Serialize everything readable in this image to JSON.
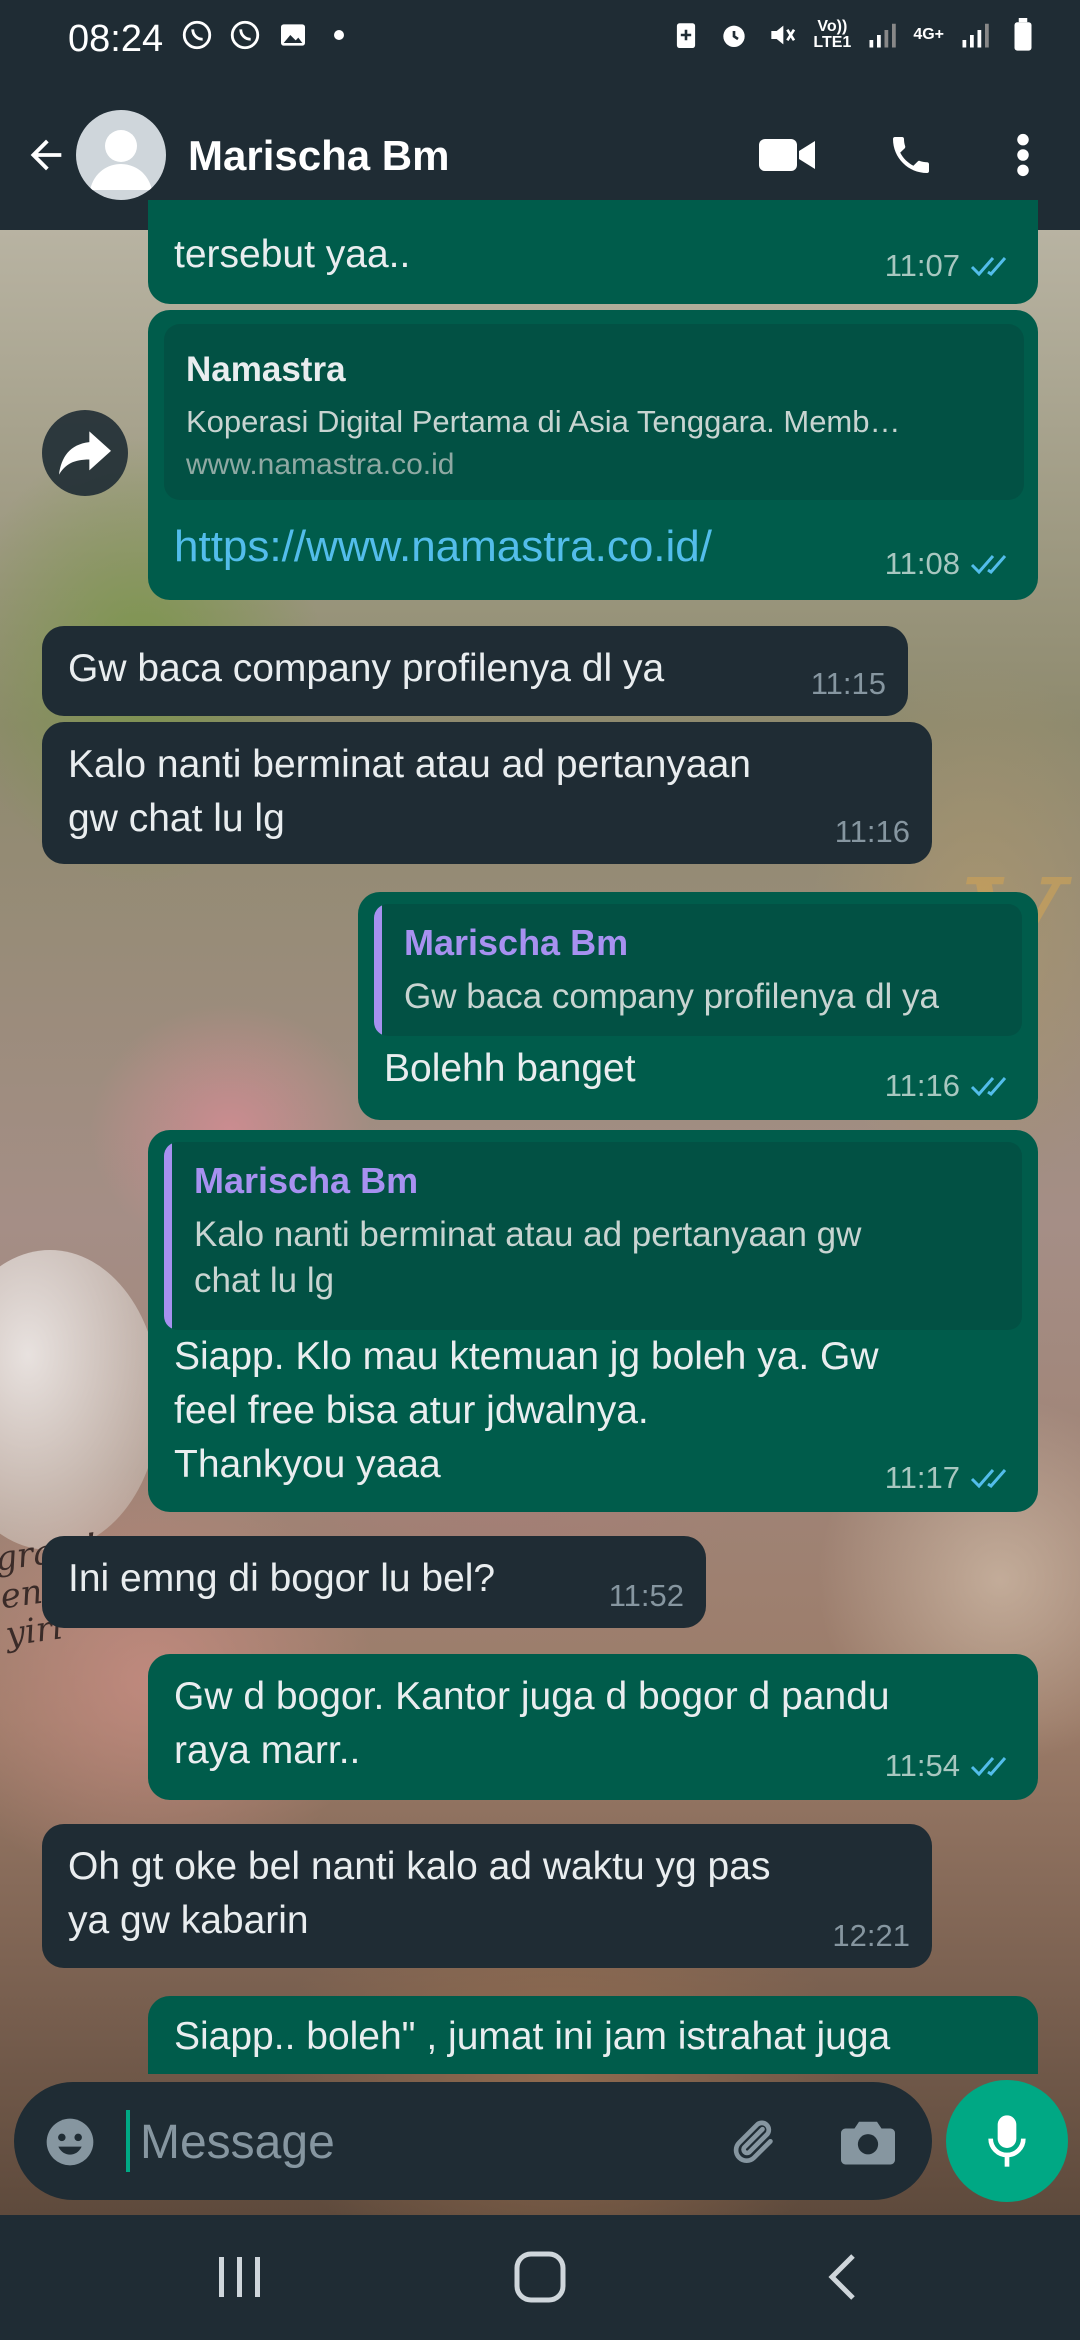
{
  "status_bar": {
    "time": "08:24",
    "network_label_top": "Vo))",
    "network_label_bottom": "LTE1",
    "network2_label": "4G+"
  },
  "header": {
    "contact_name": "Marischa Bm"
  },
  "messages": [
    {
      "direction": "out",
      "text": "tersebut yaa..",
      "time": "11:07",
      "read": true
    },
    {
      "direction": "out",
      "link_preview": {
        "title": "Namastra",
        "description": "Koperasi Digital Pertama di Asia Tenggara. Memb…",
        "domain": "www.namastra.co.id"
      },
      "text": "https://www.namastra.co.id/",
      "time": "11:08",
      "read": true
    },
    {
      "direction": "in",
      "text": "Gw baca company profilenya dl ya",
      "time": "11:15"
    },
    {
      "direction": "in",
      "text": "Kalo nanti berminat atau ad pertanyaan\ngw chat lu lg",
      "time": "11:16"
    },
    {
      "direction": "out",
      "quote": {
        "author": "Marischa Bm",
        "text": "Gw baca company profilenya dl ya"
      },
      "text": "Bolehh banget",
      "time": "11:16",
      "read": true
    },
    {
      "direction": "out",
      "quote": {
        "author": "Marischa Bm",
        "text": "Kalo nanti berminat atau ad pertanyaan gw\nchat lu lg"
      },
      "text": "Siapp. Klo mau ktemuan jg boleh ya. Gw\nfeel free bisa atur jdwalnya.\nThankyou yaaa",
      "time": "11:17",
      "read": true
    },
    {
      "direction": "in",
      "text": "Ini emng di bogor lu bel?",
      "time": "11:52"
    },
    {
      "direction": "out",
      "text": "Gw d bogor. Kantor juga d bogor d pandu\nraya marr..",
      "time": "11:54",
      "read": true
    },
    {
      "direction": "in",
      "text": "Oh gt oke bel nanti kalo ad waktu yg pas\nya gw kabarin",
      "time": "12:21"
    },
    {
      "direction": "out",
      "text": "Siapp.. boleh\" , jumat ini jam istrahat juga",
      "time": "",
      "partial": true
    }
  ],
  "composer": {
    "placeholder": "Message"
  },
  "wallpaper_text": "grats!\nengaged\nyirl",
  "colors": {
    "outgoing_bubble": "#005c4b",
    "incoming_bubble": "#1f2c34",
    "accent": "#00a884",
    "read_ticks": "#53bdeb",
    "quote_author": "#a791f0",
    "link": "#53bdeb"
  },
  "icons": [
    "back-arrow-icon",
    "avatar-icon",
    "video-call-icon",
    "voice-call-icon",
    "more-options-icon",
    "forward-icon",
    "emoji-icon",
    "attach-icon",
    "camera-icon",
    "mic-icon",
    "recent-apps-icon",
    "home-icon",
    "nav-back-icon"
  ]
}
